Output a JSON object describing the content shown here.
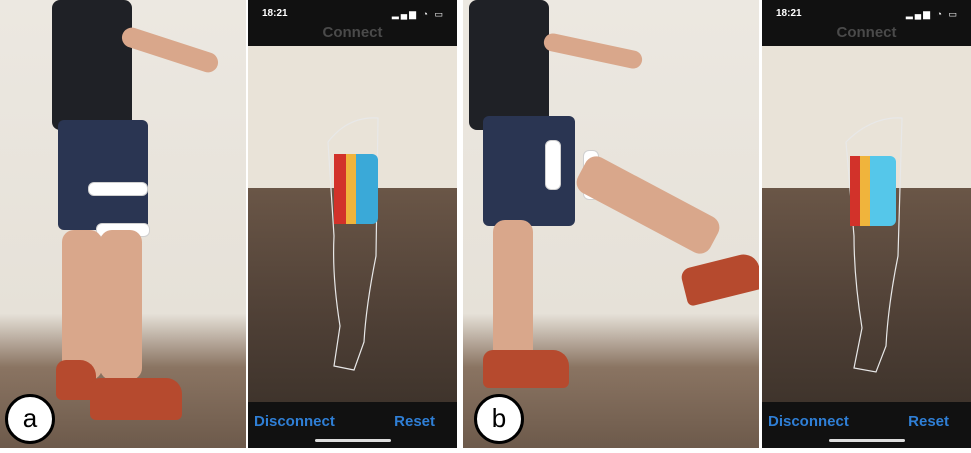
{
  "panels": [
    {
      "badge": "a",
      "status_time": "18:21",
      "status_icons": "▂▄▆ ◔ ▭",
      "header": "Connect",
      "disconnect": "Disconnect",
      "reset": "Reset"
    },
    {
      "badge": "b",
      "status_time": "18:21",
      "status_icons": "▂▄▆ ◔ ▭",
      "header": "Connect",
      "disconnect": "Disconnect",
      "reset": "Reset"
    }
  ],
  "colors": {
    "button": "#2f7fd6",
    "status_bar": "#111111",
    "heatmap_hot": "#d2322a",
    "heatmap_cold": "#2f7fd6"
  }
}
